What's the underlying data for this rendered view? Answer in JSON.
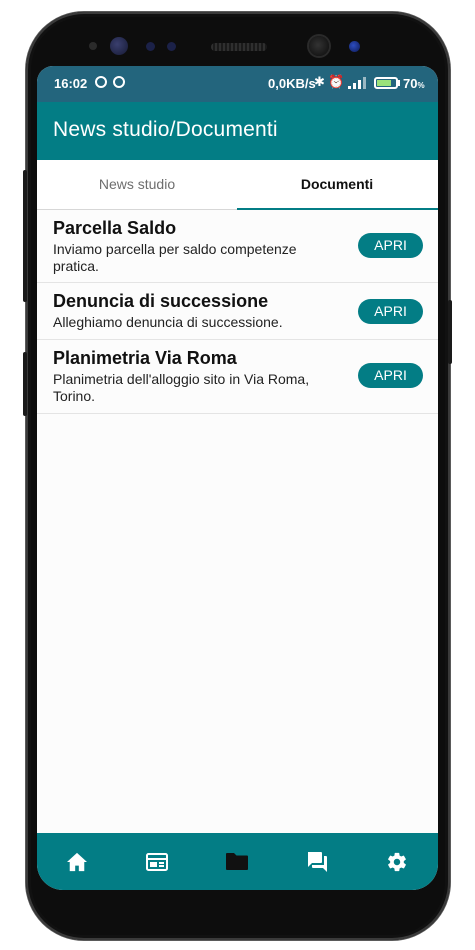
{
  "status_bar": {
    "time": "16:02",
    "network_speed": "0,0KB/s",
    "battery": "70",
    "battery_unit": "%",
    "battery_fill_fraction": 0.7,
    "icons": [
      "at-icon",
      "at-icon",
      "bluetooth-icon",
      "alarm-icon",
      "signal-icon",
      "battery-icon"
    ]
  },
  "app_bar": {
    "title": "News studio/Documenti"
  },
  "tabs": [
    {
      "label": "News studio",
      "selected": false
    },
    {
      "label": "Documenti",
      "selected": true
    }
  ],
  "documents": [
    {
      "title": "Parcella Saldo",
      "description": "Inviamo parcella per saldo competenze pratica.",
      "button": "APRI"
    },
    {
      "title": "Denuncia di successione",
      "description": "Alleghiamo denuncia di successione.",
      "button": "APRI"
    },
    {
      "title": "Planimetria Via Roma",
      "description": "Planimetria dell'alloggio sito in Via Roma, Torino.",
      "button": "APRI"
    }
  ],
  "bottom_nav": {
    "items": [
      "home-icon",
      "news-icon",
      "folder-icon",
      "chat-icon",
      "settings-icon"
    ],
    "active": "folder-icon"
  },
  "colors": {
    "status_bar": "#23657d",
    "primary": "#037d85",
    "active_nav_icon": "#111111",
    "nav_icon": "#ffffff"
  }
}
